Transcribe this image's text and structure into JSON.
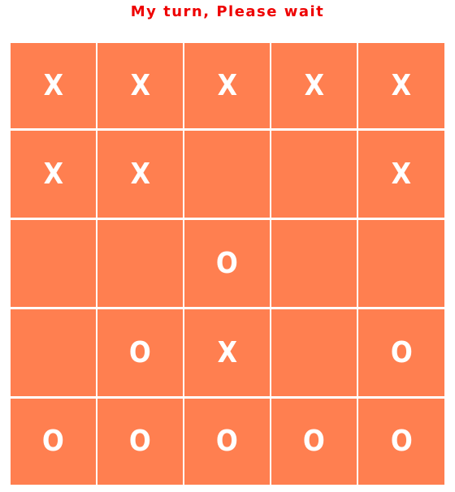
{
  "status_text": "My turn, Please wait",
  "colors": {
    "status": "#ee0000",
    "cell": "#ff7f50",
    "mark": "#ffffff"
  },
  "board": [
    [
      "X",
      "X",
      "X",
      "X",
      "X"
    ],
    [
      "X",
      "X",
      "",
      "",
      "X"
    ],
    [
      "",
      "",
      "O",
      "",
      ""
    ],
    [
      "",
      "O",
      "X",
      "",
      "O"
    ],
    [
      "O",
      "O",
      "O",
      "O",
      "O"
    ]
  ]
}
